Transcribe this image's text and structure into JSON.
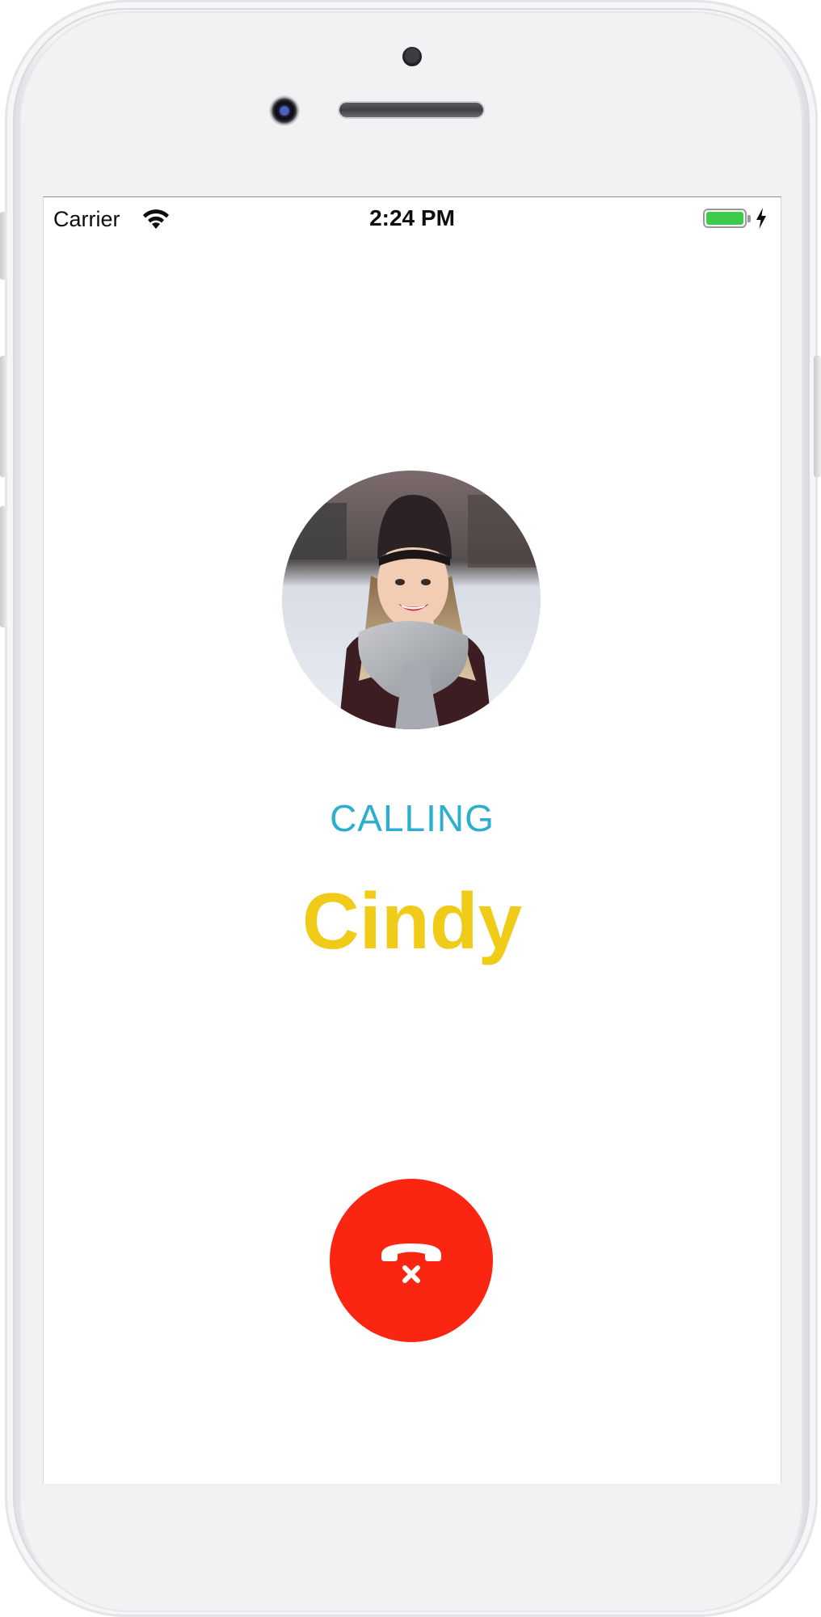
{
  "status_bar": {
    "carrier": "Carrier",
    "time": "2:24 PM",
    "battery_level": 1.0,
    "charging": true,
    "wifi_icon": "wifi-icon",
    "bolt_icon": "charging-bolt-icon"
  },
  "call": {
    "status_label": "CALLING",
    "contact_name": "Cindy",
    "end_call_icon": "hang-up-phone-icon"
  },
  "colors": {
    "status_label": "#2eaecd",
    "contact_name": "#f0cb17",
    "end_call_button": "#fb2611",
    "battery_fill": "#3ccb4a"
  }
}
